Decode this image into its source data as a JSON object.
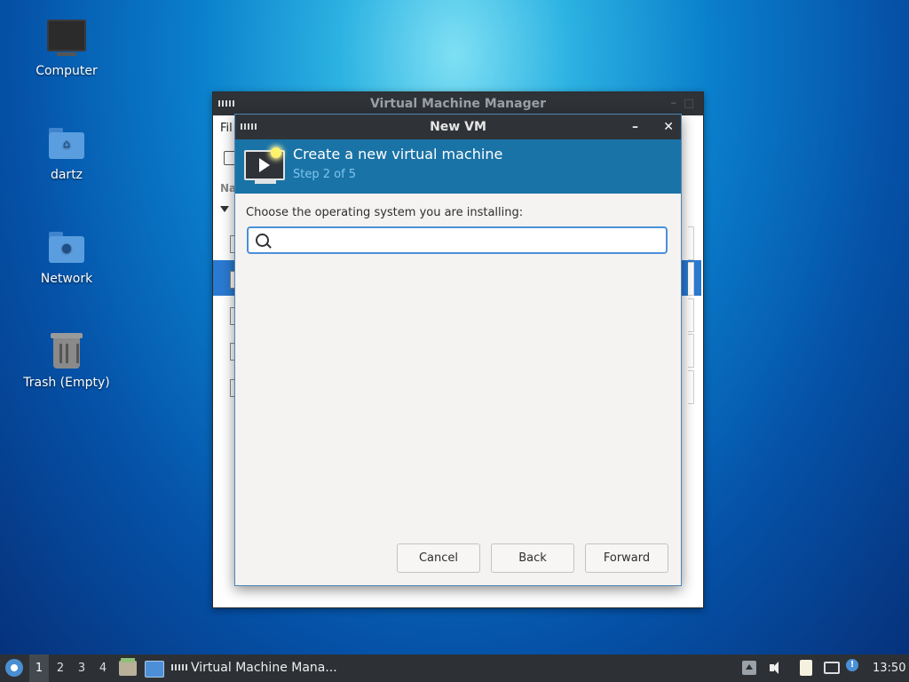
{
  "desktop": {
    "icons": [
      {
        "label": "Computer",
        "icon": "computer-icon"
      },
      {
        "label": "dartz",
        "icon": "home-folder-icon"
      },
      {
        "label": "Network",
        "icon": "network-folder-icon"
      },
      {
        "label": "Trash (Empty)",
        "icon": "trash-icon"
      }
    ]
  },
  "vmm_window": {
    "title": "Virtual Machine Manager",
    "menu_partial": "Fil",
    "column_partial": "Na"
  },
  "dialog": {
    "title": "New VM",
    "banner_title": "Create a new virtual machine",
    "banner_step": "Step 2 of 5",
    "prompt": "Choose the operating system you are installing:",
    "search_value": "",
    "search_placeholder": "",
    "buttons": {
      "cancel": "Cancel",
      "back": "Back",
      "forward": "Forward"
    }
  },
  "taskbar": {
    "workspaces": [
      "1",
      "2",
      "3",
      "4"
    ],
    "active_workspace": "1",
    "task_label": "Virtual Machine Mana...",
    "clock": "13:50"
  },
  "colors": {
    "banner": "#1a73a6",
    "selection": "#2a7ad2",
    "focus": "#4a90d9",
    "titlebar": "#2f3338"
  }
}
